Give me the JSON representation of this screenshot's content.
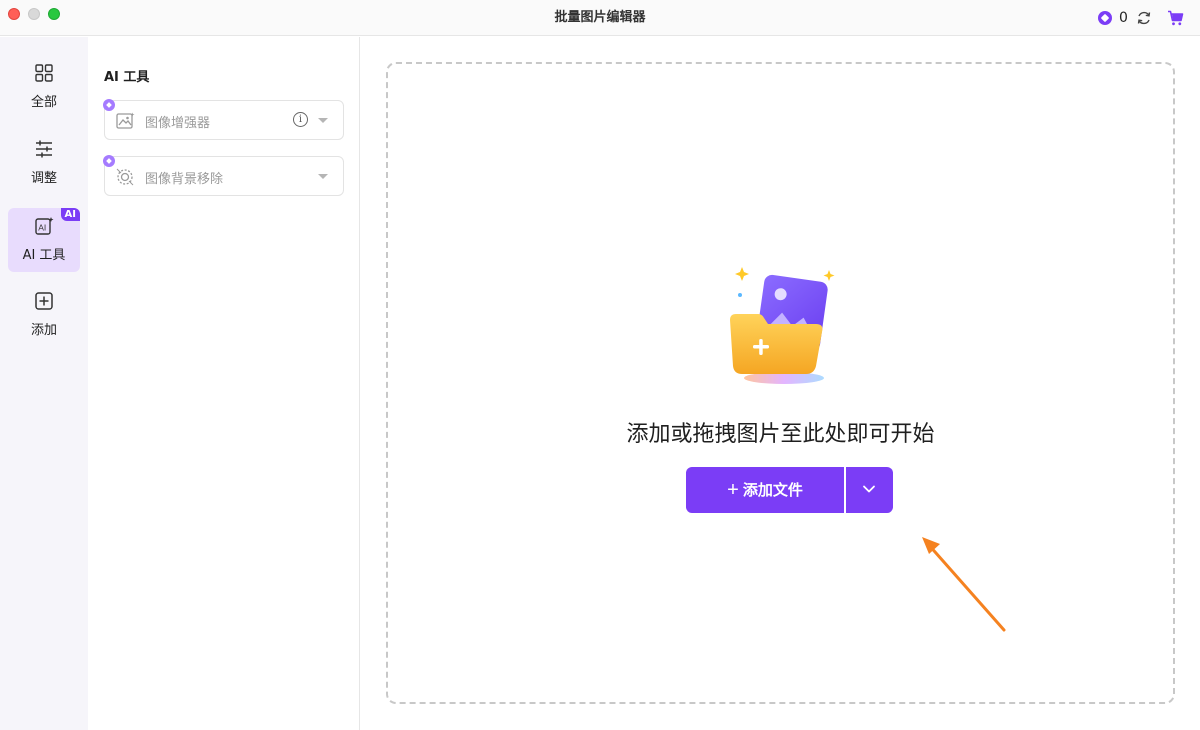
{
  "window": {
    "title": "批量图片编辑器"
  },
  "header": {
    "credits": "0"
  },
  "rail": {
    "items": [
      {
        "label": "全部",
        "icon": "grid-icon"
      },
      {
        "label": "调整",
        "icon": "sliders-icon"
      },
      {
        "label": "AI 工具",
        "icon": "ai-icon",
        "badge": "AI",
        "active": true
      },
      {
        "label": "添加",
        "icon": "plus-square-icon"
      }
    ]
  },
  "panel": {
    "title": "AI 工具",
    "tools": [
      {
        "label": "图像增强器",
        "icon": "image-enhance-icon",
        "has_info": true
      },
      {
        "label": "图像背景移除",
        "icon": "background-remove-icon",
        "has_info": false
      }
    ]
  },
  "main": {
    "drop_text": "添加或拖拽图片至此处即可开始",
    "add_button_label": "添加文件",
    "add_button_plus": "+"
  },
  "colors": {
    "accent": "#7b3df6",
    "active_bg": "#e8dcfd",
    "arrow": "#f58220"
  }
}
